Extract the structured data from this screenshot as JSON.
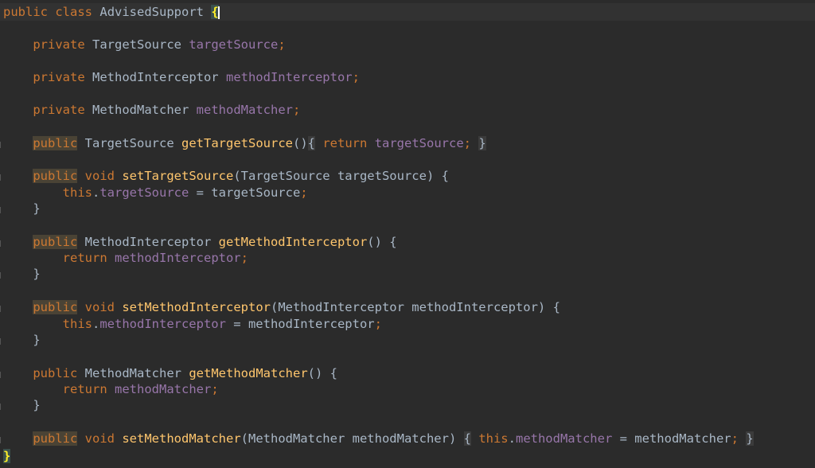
{
  "code": {
    "class_decl": {
      "kw1": "public",
      "kw2": "class",
      "name": "AdvisedSupport",
      "brace": "{"
    },
    "field1": {
      "kw": "private",
      "type": "TargetSource",
      "name": "targetSource",
      "semi": ";"
    },
    "field2": {
      "kw": "private",
      "type": "MethodInterceptor",
      "name": "methodInterceptor",
      "semi": ";"
    },
    "field3": {
      "kw": "private",
      "type": "MethodMatcher",
      "name": "methodMatcher",
      "semi": ";"
    },
    "m1": {
      "kw": "public",
      "type": "TargetSource",
      "name": "getTargetSource",
      "params": "()",
      "open": "{",
      "ret": "return",
      "val": "targetSource",
      "semi": ";",
      "close": "}"
    },
    "m2": {
      "kw": "public",
      "void": "void",
      "name": "setTargetSource",
      "params": "(TargetSource targetSource) {",
      "this": "this",
      "dot": ".",
      "field": "targetSource",
      "assign": " = targetSource",
      "semi": ";",
      "close": "}"
    },
    "m3": {
      "kw": "public",
      "type": "MethodInterceptor",
      "name": "getMethodInterceptor",
      "params": "() {",
      "ret": "return",
      "val": "methodInterceptor",
      "semi": ";",
      "close": "}"
    },
    "m4": {
      "kw": "public",
      "void": "void",
      "name": "setMethodInterceptor",
      "params": "(MethodInterceptor methodInterceptor) {",
      "this": "this",
      "dot": ".",
      "field": "methodInterceptor",
      "assign": " = methodInterceptor",
      "semi": ";",
      "close": "}"
    },
    "m5": {
      "kw": "public",
      "type": "MethodMatcher",
      "name": "getMethodMatcher",
      "params": "() {",
      "ret": "return",
      "val": "methodMatcher",
      "semi": ";",
      "close": "}"
    },
    "m6": {
      "kw": "public",
      "void": "void",
      "name": "setMethodMatcher",
      "params": "(MethodMatcher methodMatcher)",
      "open": "{",
      "this": "this",
      "dot": ".",
      "field": "methodMatcher",
      "assign": " = methodMatcher",
      "semi": ";",
      "close": "}"
    },
    "class_close": "}"
  },
  "colors": {
    "background": "#2b2b2b",
    "keyword": "#cc7832",
    "field": "#9876aa",
    "method": "#ffc66d",
    "text": "#a9b7c6"
  }
}
